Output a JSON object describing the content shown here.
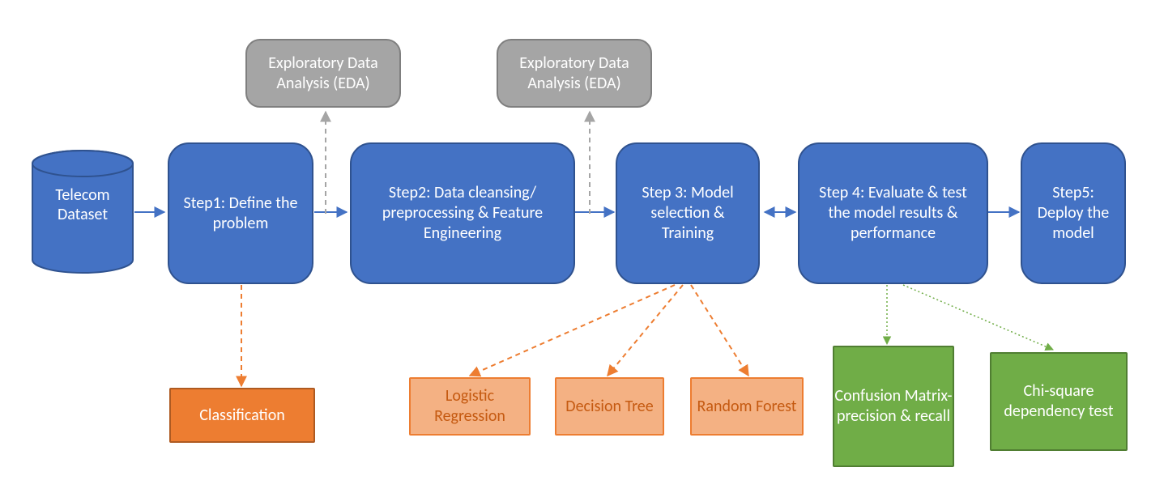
{
  "cylinder": {
    "label": "Telecom Dataset"
  },
  "steps": {
    "s1": "Step1: Define the problem",
    "s2": "Step2: Data cleansing/ preprocessing & Feature Engineering",
    "s3": "Step 3: Model selection & Training",
    "s4": "Step 4: Evaluate & test the model results & performance",
    "s5": "Step5: Deploy the model"
  },
  "eda": {
    "e1": "Exploratory Data Analysis (EDA)",
    "e2": "Exploratory Data Analysis (EDA)"
  },
  "classification": "Classification",
  "models": {
    "m1": "Logistic Regression",
    "m2": "Decision Tree",
    "m3": "Random Forest"
  },
  "evalboxes": {
    "cm": "Confusion Matrix- precision & recall",
    "chi": "Chi-square dependency test"
  },
  "colors": {
    "blue": "#4472C4",
    "blueBorder": "#2F528F",
    "grey": "#A5A5A5",
    "greyBorder": "#7F7F7F",
    "orange": "#ED7D31",
    "orangeDark": "#AE5A21",
    "orangeLight": "#F4B183",
    "green": "#70AD47",
    "greenBorder": "#507E32"
  }
}
